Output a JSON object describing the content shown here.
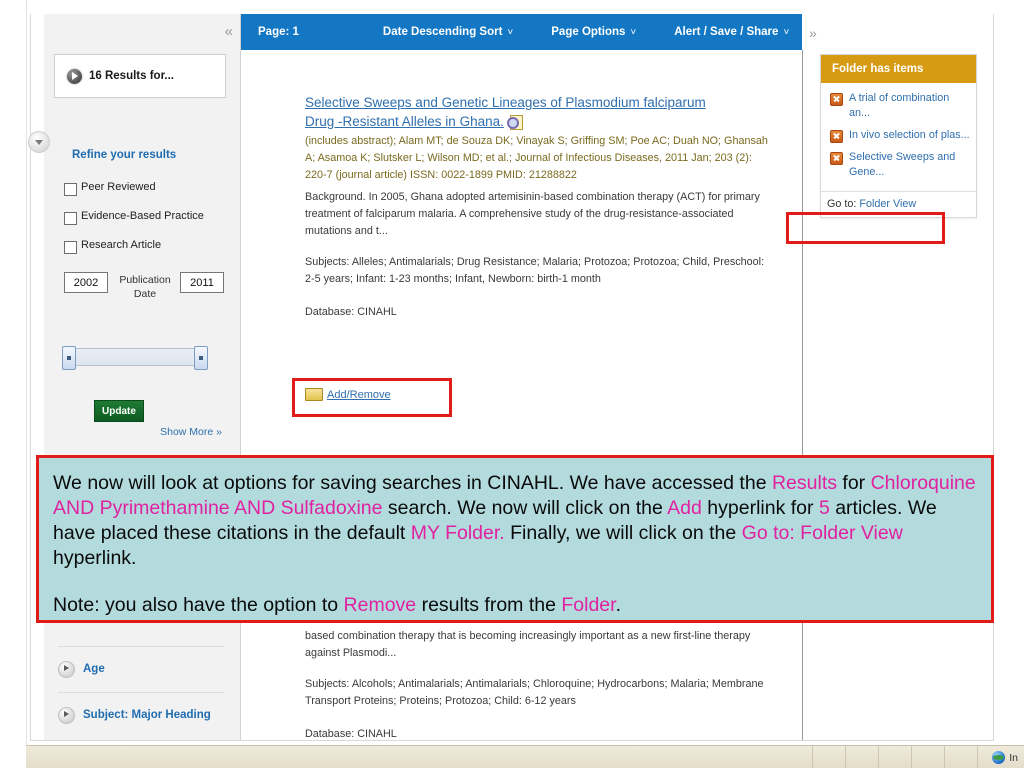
{
  "sidebar": {
    "collapse_icon": "double-chevron-left-icon",
    "results_count_label": "16 Results for...",
    "refine_title": "Refine your results",
    "limiters": [
      {
        "label": "Peer Reviewed"
      },
      {
        "label": "Evidence-Based Practice"
      },
      {
        "label": "Research Article"
      }
    ],
    "publication_date": {
      "label": "Publication Date",
      "from": "2002",
      "to": "2011"
    },
    "update_button": "Update",
    "show_more": "Show More »",
    "facet_groups": [
      {
        "label": "Age"
      },
      {
        "label": "Subject: Major Heading"
      }
    ]
  },
  "toolbar": {
    "page_label": "Page: 1",
    "menus": [
      {
        "label": "Date Descending Sort",
        "chevron": "˅"
      },
      {
        "label": "Page Options",
        "chevron": "˅"
      },
      {
        "label": "Alert / Save / Share",
        "chevron": "˅"
      }
    ]
  },
  "record": {
    "title_line1": "Selective Sweeps and Genetic Lineages of Plasmodium falciparum",
    "title_line2": "Drug -Resistant Alleles in Ghana.",
    "pdf_icon": "pdf-preview-icon",
    "meta": "(includes abstract); Alam MT; de Souza DK; Vinayak S; Griffing SM; Poe AC; Duah NO; Ghansah A; Asamoa K; Slutsker L; Wilson MD; et al.; Journal of Infectious Diseases, 2011 Jan; 203 (2): 220-7 (journal article) ISSN: 0022-1899 PMID: 21288822",
    "abstract": "Background. In 2005, Ghana adopted artemisinin-based combination therapy (ACT) for primary treatment of falciparum malaria. A comprehensive study of the drug-resistance-associated mutations and t...",
    "subjects": "Subjects: Alleles; Antimalarials; Drug Resistance; Malaria; Protozoa; Protozoa; Child, Preschool: 2-5 years; Infant: 1-23 months; Infant, Newborn: birth-1 month",
    "database": "Database: CINAHL",
    "add_remove_label": "Add/Remove",
    "folder_icon": "folder-icon"
  },
  "record_below": {
    "abstract_tail": "based combination therapy that is becoming increasingly important as a new first-line therapy against Plasmodi...",
    "subjects": "Subjects: Alcohols; Antimalarials; Antimalarials; Chloroquine; Hydrocarbons; Malaria; Membrane Transport Proteins; Proteins; Protozoa; Child: 6-12 years",
    "database": "Database: CINAHL"
  },
  "folder_panel": {
    "expand_icon": "double-chevron-right-icon",
    "header": "Folder has items",
    "items": [
      {
        "remove_icon": "remove-x-icon",
        "label": "A trial of combination an..."
      },
      {
        "remove_icon": "remove-x-icon",
        "label": "In vivo selection of plas..."
      },
      {
        "remove_icon": "remove-x-icon",
        "label": "Selective Sweeps and Gene..."
      }
    ],
    "goto_prefix": "Go to:",
    "goto_link": "Folder View"
  },
  "callout": {
    "p1_a": "We now will look at options for saving searches in CINAHL.  We have accessed the ",
    "p1_hl1": "Results",
    "p1_b": "  for ",
    "p1_hl2": "Chloroquine AND Pyrimethamine AND Sulfadoxine",
    "p1_c": " search.  We now will click on the ",
    "p1_hl3": "Add",
    "p1_d": " hyperlink for ",
    "p1_hl4": "5",
    "p1_e": " articles.  We have placed these citations in the default ",
    "p1_hl5": "MY Folder.",
    "p1_f": "   Finally, we will click on the ",
    "p1_hl6": "Go to: Folder View",
    "p1_g": " hyperlink.",
    "p2_a": "Note: you also have the option to ",
    "p2_hl1": "Remove",
    "p2_b": " results from the ",
    "p2_hl2": "Folder",
    "p2_c": "."
  },
  "statusbar": {
    "zone_icon": "globe-icon",
    "zone_text": "In"
  },
  "colors": {
    "toolbar_blue": "#1477c4",
    "folder_header_orange": "#d79b13",
    "highlight_red": "#e01b18",
    "callout_bg": "#b3dbde",
    "magenta": "#e021a0",
    "link_blue": "#2f6fae"
  }
}
